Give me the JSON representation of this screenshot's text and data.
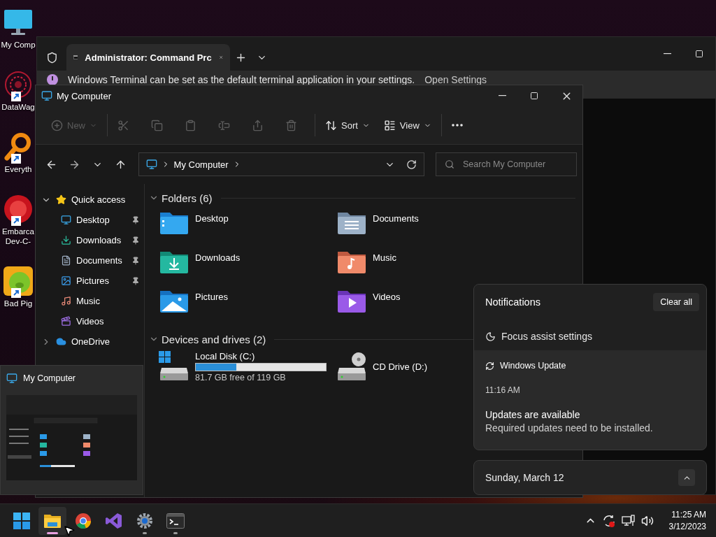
{
  "desktop_icons": [
    {
      "label": "My Comp",
      "kind": "monitor",
      "shortcut": false
    },
    {
      "label": "DataWag",
      "kind": "burst",
      "shortcut": true
    },
    {
      "label": "Everyth",
      "kind": "magnifier",
      "shortcut": true
    },
    {
      "label": "Embarca Dev-C-",
      "kind": "devcpp",
      "shortcut": true
    },
    {
      "label": "Bad Pig",
      "kind": "game",
      "shortcut": true
    }
  ],
  "terminal": {
    "tab_title": "Administrator: Command Prc",
    "infobar": {
      "message": "Windows Terminal can be set as the default terminal application in your settings.",
      "link": "Open Settings"
    }
  },
  "explorer": {
    "title": "My Computer",
    "toolbar_groups": [
      {
        "items": [
          {
            "label": "New",
            "kind": "new",
            "disabled": true
          }
        ]
      },
      {
        "items": [
          {
            "kind": "cut",
            "disabled": true
          },
          {
            "kind": "copy",
            "disabled": true
          },
          {
            "kind": "paste",
            "disabled": true
          },
          {
            "kind": "rename",
            "disabled": true
          },
          {
            "kind": "share",
            "disabled": true
          },
          {
            "kind": "delete",
            "disabled": true
          }
        ]
      },
      {
        "items": [
          {
            "label": "Sort",
            "kind": "sort",
            "disabled": false
          },
          {
            "label": "View",
            "kind": "view",
            "disabled": false
          }
        ]
      },
      {
        "items": [
          {
            "kind": "more",
            "disabled": false
          }
        ]
      }
    ],
    "address": {
      "path": "My Computer"
    },
    "search": {
      "placeholder": "Search My Computer"
    },
    "sidebar": {
      "items": [
        {
          "label": "Quick access",
          "kind": "star",
          "expanded": true,
          "children": [
            {
              "label": "Desktop",
              "kind": "desktop",
              "pinned": true
            },
            {
              "label": "Downloads",
              "kind": "downloads",
              "pinned": true
            },
            {
              "label": "Documents",
              "kind": "documents",
              "pinned": true
            },
            {
              "label": "Pictures",
              "kind": "pictures",
              "pinned": true
            },
            {
              "label": "Music",
              "kind": "music",
              "pinned": false
            },
            {
              "label": "Videos",
              "kind": "videos",
              "pinned": false
            }
          ]
        },
        {
          "label": "OneDrive",
          "kind": "cloud",
          "expanded": false
        }
      ]
    },
    "folders": {
      "title": "Folders (6)",
      "expanded": true,
      "items": [
        {
          "label": "Desktop",
          "kind": "desktop"
        },
        {
          "label": "Documents",
          "kind": "documents"
        },
        {
          "label": "Downloads",
          "kind": "downloads"
        },
        {
          "label": "Music",
          "kind": "music"
        },
        {
          "label": "Pictures",
          "kind": "pictures"
        },
        {
          "label": "Videos",
          "kind": "videos"
        }
      ]
    },
    "drives": {
      "title": "Devices and drives (2)",
      "expanded": true,
      "items": [
        {
          "label": "Local Disk (C:)",
          "kind": "disk",
          "level": 0.31,
          "free": "81.7 GB free of 119 GB"
        },
        {
          "label": "CD Drive (D:)",
          "kind": "cd"
        }
      ]
    }
  },
  "preview": {
    "title": "My Computer"
  },
  "notifications": {
    "title": "Notifications",
    "clear_button": "Clear all",
    "focus_assist": "Focus assist settings",
    "items": [
      {
        "app": "Windows Update",
        "time": "11:16 AM",
        "heading": "Updates are available",
        "body": "Required updates need to be installed."
      }
    ]
  },
  "calendar": {
    "date": "Sunday, March 12",
    "expanded": false
  },
  "taskbar": {
    "apps": [
      {
        "kind": "start",
        "running": false,
        "selected": false
      },
      {
        "kind": "explorer",
        "running": true,
        "selected": true
      },
      {
        "kind": "chrome",
        "running": false,
        "selected": false
      },
      {
        "kind": "studio",
        "running": false,
        "selected": false
      },
      {
        "kind": "settings",
        "running": true,
        "selected": false
      },
      {
        "kind": "terminal",
        "running": true,
        "selected": false
      }
    ],
    "clock": {
      "time": "11:25 AM",
      "date": "3/12/2023"
    }
  }
}
